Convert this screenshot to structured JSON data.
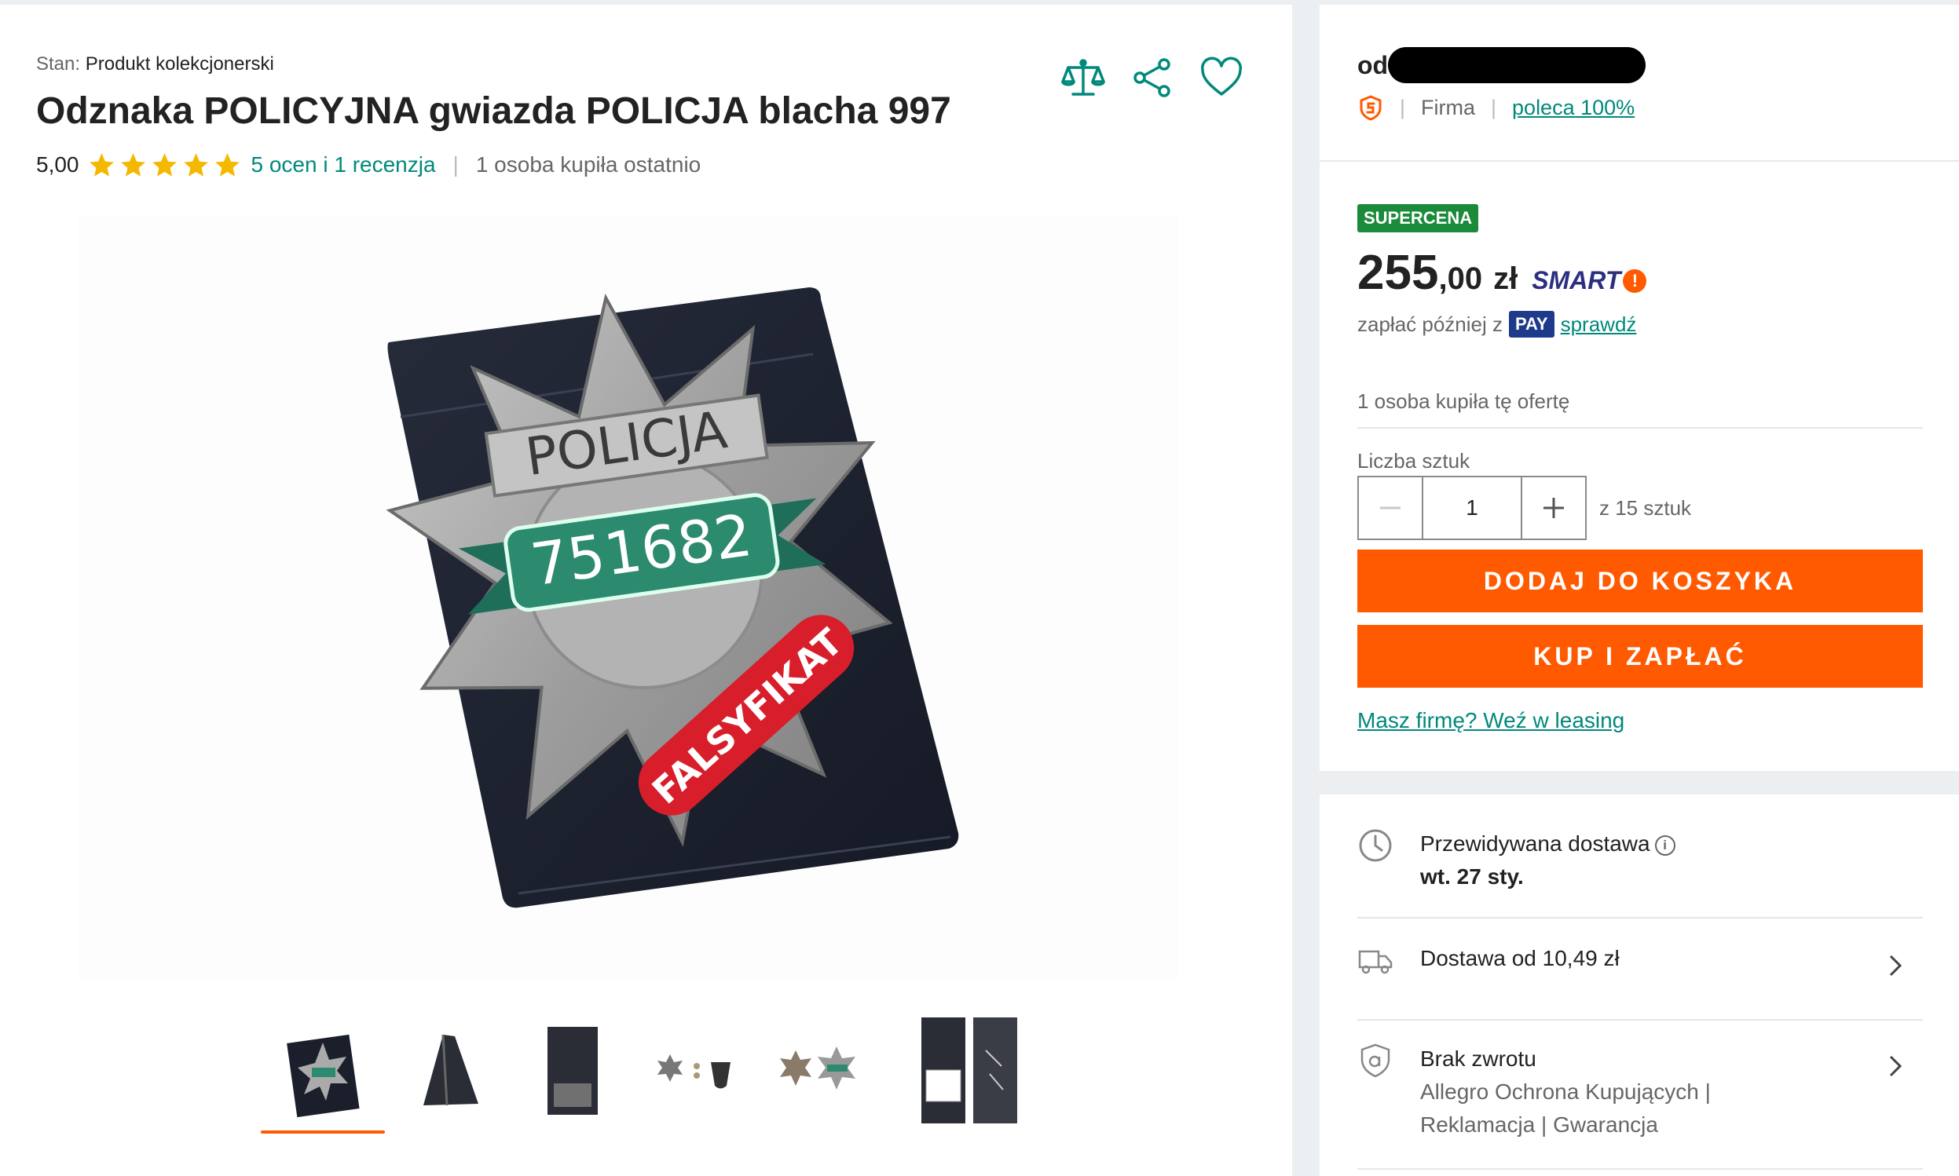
{
  "product": {
    "condition_label": "Stan:",
    "condition_value": "Produkt kolekcjonerski",
    "title": "Odznaka POLICYJNA gwiazda POLICJA blacha 997",
    "rating_value": "5,00",
    "stars": 5,
    "reviews_link": "5 ocen i 1 recenzja",
    "bought_recently": "1 osoba kupiła ostatnio"
  },
  "image_text": {
    "badge_word": "POLICJA",
    "badge_number": "751682",
    "sticker": "FALSYFIKAT"
  },
  "actions": {
    "compare_icon": "scales-icon",
    "share_icon": "share-icon",
    "favorite_icon": "heart-icon"
  },
  "thumbnails": [
    "thumb-1",
    "thumb-2",
    "thumb-3",
    "thumb-4",
    "thumb-5"
  ],
  "seller": {
    "prefix": "od",
    "type": "Firma",
    "recommend": "poleca 100%"
  },
  "offer": {
    "badge": "SUPERCENA",
    "price_int": "255",
    "price_dec": ",00",
    "currency": "zł",
    "smart_label": "SMART",
    "smart_mark": "!",
    "pay_later": "zapłać później z",
    "pay_badge": "PAY",
    "pay_check": "sprawdź",
    "bought_offer": "1 osoba kupiła tę ofertę",
    "qty_label": "Liczba sztuk",
    "qty_value": "1",
    "qty_stock": "z 15 sztuk",
    "add_to_cart": "DODAJ DO KOSZYKA",
    "buy_now": "KUP I ZAPŁAĆ",
    "leasing": "Masz firmę? Weź w leasing"
  },
  "delivery": {
    "expected_label": "Przewidywana dostawa",
    "expected_date": "wt. 27 sty.",
    "shipping": "Dostawa od 10,49 zł",
    "return_title": "Brak zwrotu",
    "protection_line1": "Allegro Ochrona Kupujących |",
    "protection_line2": "Reklamacja | Gwarancja"
  },
  "colors": {
    "accent_teal": "#00897b",
    "orange": "#ff5a00",
    "supercena_green": "#1b8a3a",
    "star_yellow": "#f5b800"
  }
}
